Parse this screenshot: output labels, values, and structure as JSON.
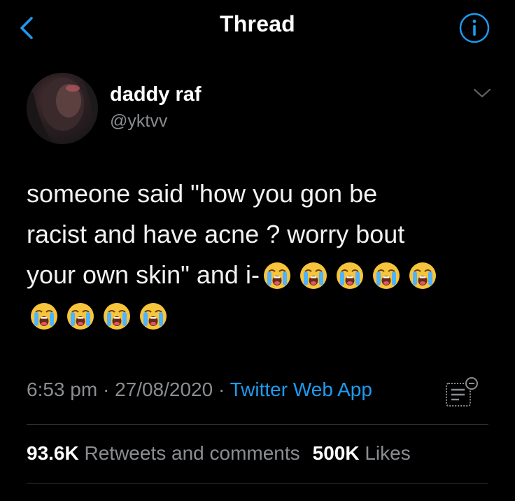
{
  "nav": {
    "title": "Thread",
    "back_icon": "chevron-left-icon",
    "info_icon": "info-icon"
  },
  "author": {
    "name": "daddy raf",
    "handle": "@yktvv"
  },
  "tweet": {
    "line1": "someone said \"how you gon be",
    "line2": "racist and have acne ? worry bout",
    "line3_text": "your own skin\" and i-",
    "emoji": "loudly-crying-face",
    "emoji_count": 9
  },
  "meta": {
    "time": "6:53 pm",
    "sep": " · ",
    "date": "27/08/2020",
    "app": "Twitter Web App"
  },
  "stats": {
    "retweets_value": "93.6K",
    "retweets_label": "Retweets and comments",
    "likes_value": "500K",
    "likes_label": "Likes"
  },
  "colors": {
    "accent": "#1d9bf0",
    "muted": "#8a8d91",
    "background": "#000000"
  }
}
